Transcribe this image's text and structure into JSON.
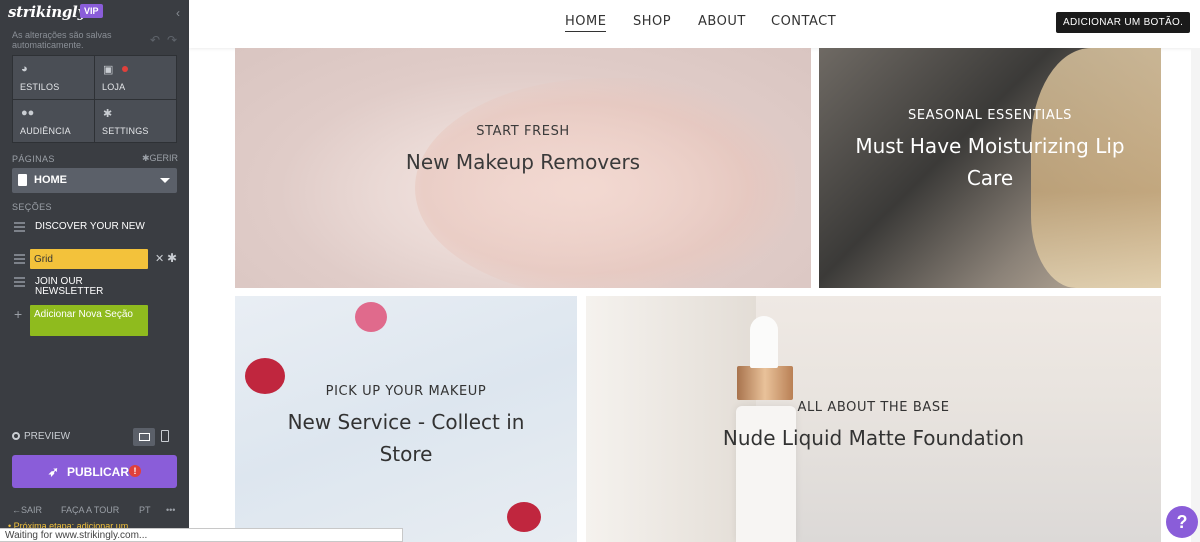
{
  "sidebar": {
    "logo": "strikingly",
    "badge": "VIP",
    "autosave": "As alterações são salvas automaticamente.",
    "tiles": [
      {
        "label": "ESTILOS",
        "icon": "palette-icon"
      },
      {
        "label": "LOJA",
        "icon": "shopping-bag-icon"
      },
      {
        "label": "AUDIÊNCIA",
        "icon": "people-icon"
      },
      {
        "label": "SETTINGS",
        "icon": "gear-icon"
      }
    ],
    "pages_label": "PÁGINAS",
    "manage_label": "GERIR",
    "current_page": "HOME",
    "sections_label": "SEÇÕES",
    "sections": [
      "DISCOVER YOUR NEW",
      "Grid",
      "JOIN OUR NEWSLETTER"
    ],
    "add_section": "Adicionar Nova Seção",
    "preview_label": "PREVIEW",
    "publish_label": "PUBLICAR",
    "footer": {
      "exit": "SAIR",
      "tour": "FAÇA A TOUR",
      "lang": "PT",
      "more": "•••"
    },
    "next_step": "• Próxima etapa: adicionar um"
  },
  "topnav": {
    "links": [
      "HOME",
      "SHOP",
      "ABOUT",
      "CONTACT"
    ],
    "active": "HOME",
    "cta": "ADICIONAR UM BOTÃO."
  },
  "cards": [
    {
      "kicker": "START FRESH",
      "headline": "New Makeup Removers"
    },
    {
      "kicker": "SEASONAL ESSENTIALS",
      "headline": "Must Have Moisturizing Lip Care"
    },
    {
      "kicker": "PICK UP YOUR MAKEUP",
      "headline": "New Service - Collect in Store"
    },
    {
      "kicker": "ALL ABOUT THE BASE",
      "headline": "Nude Liquid Matte Foundation"
    }
  ],
  "help": "?",
  "status": "Waiting for www.strikingly.com..."
}
